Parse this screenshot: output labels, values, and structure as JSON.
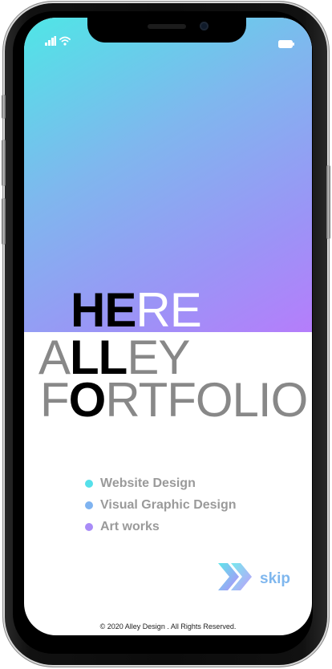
{
  "brand": {
    "line1_bold": "HE",
    "line1_light": "RE",
    "line2_light_before": "A",
    "line2_bold": "LL",
    "line2_light_after": "EY",
    "line3_light_before": "F",
    "line3_bold": "O",
    "line3_light_after": "RTFOLIO"
  },
  "services": {
    "items": [
      {
        "label": "Website Design",
        "color": "#55e0ea"
      },
      {
        "label": "Visual Graphic Design",
        "color": "#7fb3f0"
      },
      {
        "label": "Art works",
        "color": "#a98cf7"
      }
    ]
  },
  "skip": {
    "label": "skip"
  },
  "footer": {
    "copyright": "© 2020 Alley Design . All Rights Reserved."
  },
  "colors": {
    "gradient_start": "#4fe6e6",
    "gradient_end": "#b57dfb",
    "accent": "#7fb7ee"
  },
  "icons": {
    "signal": "signal-icon",
    "wifi": "wifi-icon",
    "battery": "battery-icon",
    "skip": "double-chevron-right-icon"
  }
}
